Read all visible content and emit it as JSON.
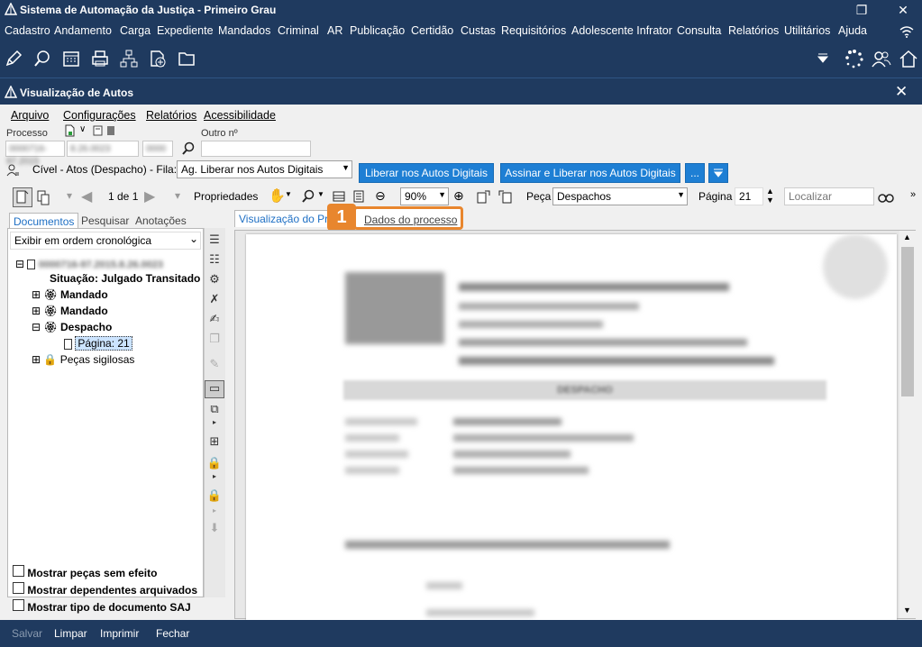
{
  "app": {
    "title": "Sistema de Automação da Justiça - Primeiro Grau",
    "menu": [
      "Cadastro",
      "Andamento",
      "Carga",
      "Expediente",
      "Mandados",
      "Criminal",
      "AR",
      "Publicação",
      "Certidão",
      "Custas",
      "Requisitórios",
      "Adolescente Infrator",
      "Consulta",
      "Relatórios",
      "Utilitários",
      "Ajuda"
    ]
  },
  "window": {
    "title": "Visualização de Autos",
    "menu": [
      "Arquivo",
      "Configurações",
      "Relatórios",
      "Acessibilidade"
    ]
  },
  "processo": {
    "label": "Processo",
    "outro_label": "Outro nº",
    "number_parts": [
      "0000716-97.2015",
      "8.26.0023",
      "0000"
    ]
  },
  "fila": {
    "prefix": "Cível - Atos (Despacho) - Fila:",
    "value": "Ag. Liberar nos Autos Digitais",
    "btn_liberar": "Liberar nos Autos Digitais",
    "btn_assinar": "Assinar e Liberar nos Autos Digitais",
    "btn_more": "..."
  },
  "toolbar": {
    "page_indicator": "1 de 1",
    "propriedades": "Propriedades",
    "zoom": "90%",
    "peca_label": "Peça",
    "peca_value": "Despachos",
    "pagina_label": "Página",
    "pagina_value": "21",
    "localizar_placeholder": "Localizar"
  },
  "left_tabs": [
    "Documentos",
    "Pesquisar",
    "Anotações"
  ],
  "order_select": "Exibir em ordem cronológica",
  "tree": {
    "root_number": "0000716-97.2015.8.26.0023",
    "situacao": "Situação: Julgado Transitado",
    "items": [
      "Mandado",
      "Mandado",
      "Despacho"
    ],
    "page_item": "Página: 21",
    "sigilosas": "Peças sigilosas"
  },
  "checkboxes": [
    "Mostrar peças sem efeito",
    "Mostrar dependentes arquivados",
    "Mostrar tipo de documento SAJ"
  ],
  "viewer_tabs": [
    "Visualização do Pro",
    "Dados do processo"
  ],
  "callout": "1",
  "doc": {
    "banner": "DESPACHO"
  },
  "footer": [
    "Salvar",
    "Limpar",
    "Imprimir",
    "Fechar"
  ],
  "colors": {
    "titlebar": "#1f3a5f",
    "accent_blue": "#1e7fd4",
    "callout_orange": "#e8862e"
  }
}
